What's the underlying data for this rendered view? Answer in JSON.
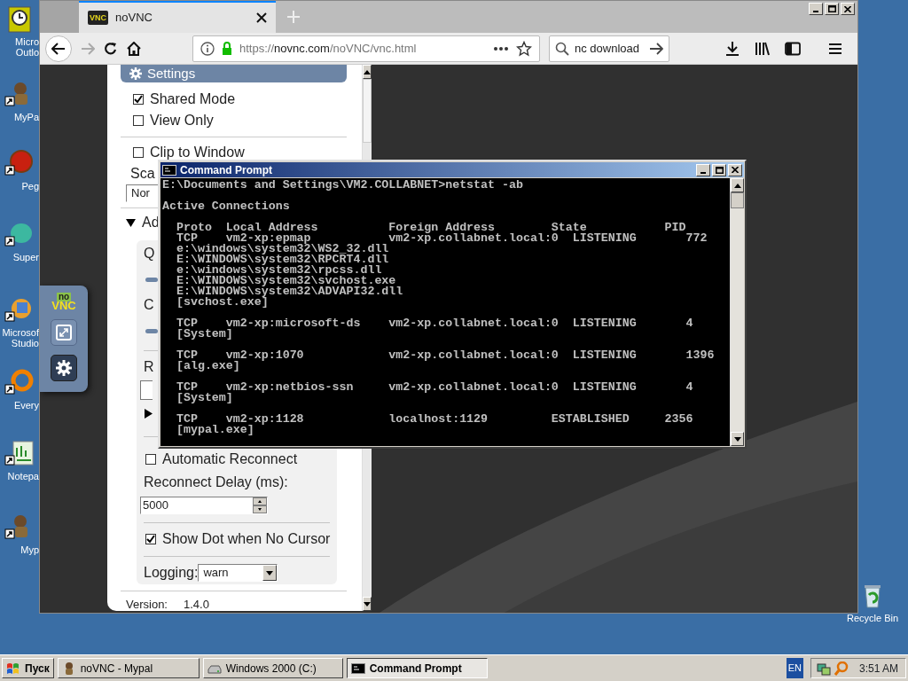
{
  "desktop_icons": [
    {
      "kind": "clock",
      "label": [
        "Micro",
        "Outlo"
      ]
    },
    {
      "kind": "figure",
      "label": [
        "MyPa"
      ]
    },
    {
      "kind": "ball",
      "label": [
        "Peg"
      ]
    },
    {
      "kind": "gem",
      "label": [
        "Super"
      ]
    },
    {
      "kind": "puzzle",
      "label": [
        "Microsof",
        "Studio"
      ]
    },
    {
      "kind": "ring",
      "label": [
        "Every"
      ]
    },
    {
      "kind": "chart",
      "label": [
        "Notepa"
      ]
    },
    {
      "kind": "figure",
      "label": [
        "Myp"
      ]
    }
  ],
  "recycle_bin": {
    "label": "Recycle Bin"
  },
  "browser": {
    "tabs": [
      {
        "title": "noVNC",
        "favicon": "VNC",
        "selected": true
      }
    ],
    "forward_disabled": true,
    "url": {
      "scheme": "https://",
      "host": "novnc.com",
      "path": "/noVNC/vnc.html"
    },
    "search_text": "nc download"
  },
  "control_bar": {
    "logo": [
      "no",
      "VNC"
    ],
    "buttons": [
      {
        "kind": "fullscreen",
        "selected": false
      },
      {
        "kind": "settings",
        "selected": true
      }
    ]
  },
  "settings": {
    "title": "Settings",
    "items": [
      {
        "kind": "checkbox",
        "label": "Shared Mode",
        "checked": true
      },
      {
        "kind": "checkbox",
        "label": "View Only",
        "checked": false
      },
      {
        "kind": "divider"
      },
      {
        "kind": "checkbox",
        "label": "Clip to Window",
        "checked": false
      },
      {
        "kind": "label",
        "label": "Sca"
      },
      {
        "kind": "select",
        "value": "Nor"
      },
      {
        "kind": "divider"
      },
      {
        "kind": "section",
        "label": "Ad",
        "expanded": true,
        "items": [
          {
            "kind": "label",
            "label": "Q"
          },
          {
            "kind": "slider"
          },
          {
            "kind": "label",
            "label": "C"
          },
          {
            "kind": "slider"
          },
          {
            "kind": "divider"
          },
          {
            "kind": "label",
            "label": "R"
          },
          {
            "kind": "field"
          },
          {
            "kind": "section",
            "expanded": false
          },
          {
            "kind": "divider"
          },
          {
            "kind": "checkbox",
            "label": "Automatic Reconnect",
            "checked": false
          },
          {
            "kind": "label",
            "label": "Reconnect Delay (ms):"
          },
          {
            "kind": "spinner",
            "value": "5000"
          },
          {
            "kind": "divider"
          },
          {
            "kind": "checkbox",
            "label": "Show Dot when No Cursor",
            "checked": true
          },
          {
            "kind": "divider"
          },
          {
            "kind": "select",
            "label": "Logging:",
            "value": "warn"
          }
        ]
      },
      {
        "kind": "divider"
      },
      {
        "kind": "info",
        "label": "Version:",
        "value": "1.4.0"
      }
    ]
  },
  "console": {
    "title": "Command Prompt",
    "blocks": [
      [
        "E:\\Documents and Settings\\VM2.COLLABNET>netstat -ab"
      ],
      [
        "Active Connections"
      ],
      [
        "  Proto  Local Address          Foreign Address        State           PID",
        "  TCP    vm2-xp:epmap           vm2-xp.collabnet.local:0  LISTENING       772",
        "  e:\\windows\\system32\\WS2_32.dll",
        "  E:\\WINDOWS\\system32\\RPCRT4.dll",
        "  e:\\windows\\system32\\rpcss.dll",
        "  E:\\WINDOWS\\system32\\svchost.exe",
        "  E:\\WINDOWS\\system32\\ADVAPI32.dll",
        "  [svchost.exe]"
      ],
      [
        "  TCP    vm2-xp:microsoft-ds    vm2-xp.collabnet.local:0  LISTENING       4",
        "  [System]"
      ],
      [
        "  TCP    vm2-xp:1070            vm2-xp.collabnet.local:0  LISTENING       1396",
        "  [alg.exe]"
      ],
      [
        "  TCP    vm2-xp:netbios-ssn     vm2-xp.collabnet.local:0  LISTENING       4",
        "  [System]"
      ],
      [
        "  TCP    vm2-xp:1128            localhost:1129         ESTABLISHED     2356",
        "  [mypal.exe]"
      ]
    ]
  },
  "taskbar": {
    "start": "Пуск",
    "tasks": [
      {
        "kind": "browser",
        "label": "noVNC - Mypal",
        "selected": false
      },
      {
        "kind": "drive",
        "label": "Windows 2000 (C:)",
        "selected": false
      },
      {
        "kind": "console",
        "label": "Command Prompt",
        "selected": true
      }
    ],
    "language": "EN",
    "clock": "3:51 AM"
  }
}
